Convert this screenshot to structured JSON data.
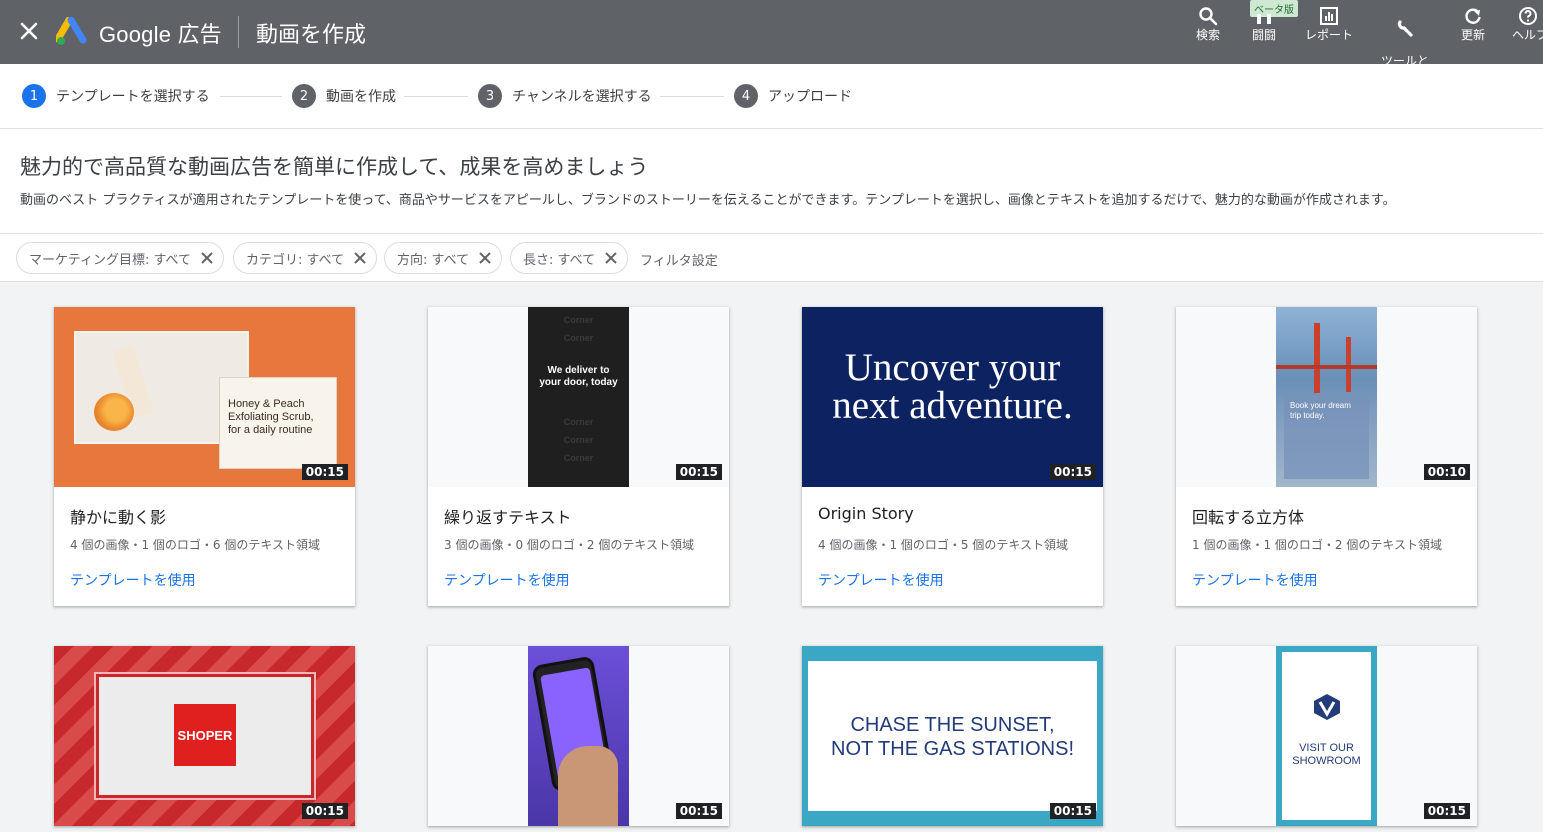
{
  "topbar": {
    "brand": "Google 広告",
    "title": "動画を作成",
    "beta_badge": "ベータ版",
    "tools": [
      {
        "label": "検索",
        "icon": "search-icon"
      },
      {
        "label": "闘闘",
        "icon": "chart-icon"
      },
      {
        "label": "レポート",
        "icon": "report-icon"
      },
      {
        "label": "ツールと\n設定",
        "icon": "wrench-icon"
      },
      {
        "label": "更新",
        "icon": "refresh-icon"
      },
      {
        "label": "ヘルプ",
        "icon": "help-icon"
      }
    ]
  },
  "stepper": {
    "steps": [
      {
        "num": "1",
        "label": "テンプレートを選択する"
      },
      {
        "num": "2",
        "label": "動画を作成"
      },
      {
        "num": "3",
        "label": "チャンネルを選択する"
      },
      {
        "num": "4",
        "label": "アップロード"
      }
    ]
  },
  "intro": {
    "heading": "魅力的で高品質な動画広告を簡単に作成して、成果を高めましょう",
    "description": "動画のベスト プラクティスが適用されたテンプレートを使って、商品やサービスをアピールし、ブランドのストーリーを伝えることができます。テンプレートを選択し、画像とテキストを追加するだけで、魅力的な動画が作成されます。"
  },
  "filters": {
    "chips": [
      "マーケティング目標: すべて",
      "カテゴリ: すべて",
      "方向: すべて",
      "長さ: すべて"
    ],
    "settings": "フィルタ設定"
  },
  "cards": [
    {
      "title": "静かに動く影",
      "meta": "4 個の画像・1 個のロゴ・6 個のテキスト領域",
      "duration": "00:15",
      "link": "テンプレートを使用",
      "thumb_text": "Honey & Peach\nExfoliating Scrub,\nfor a daily routine"
    },
    {
      "title": "繰り返すテキスト",
      "meta": "3 個の画像・0 個のロゴ・2 個のテキスト領域",
      "duration": "00:15",
      "link": "テンプレートを使用",
      "thumb_text": "We deliver to\nyour door, today",
      "ghost": "Corner"
    },
    {
      "title": "Origin Story",
      "meta": "4 個の画像・1 個のロゴ・5 個のテキスト領域",
      "duration": "00:15",
      "link": "テンプレートを使用",
      "thumb_text": "Uncover your\nnext adventure."
    },
    {
      "title": "回転する立方体",
      "meta": "1 個の画像・1 個のロゴ・2 個のテキスト領域",
      "duration": "00:10",
      "link": "テンプレートを使用",
      "thumb_text": "Book your dream\ntrip today."
    },
    {
      "duration": "00:15",
      "thumb_text": "SHOPER"
    },
    {
      "duration": "00:15"
    },
    {
      "duration": "00:15",
      "thumb_text": "CHASE THE SUNSET,\nNOT THE GAS STATIONS!"
    },
    {
      "duration": "00:15",
      "thumb_text": "VISIT OUR\nSHOWROOM"
    }
  ]
}
